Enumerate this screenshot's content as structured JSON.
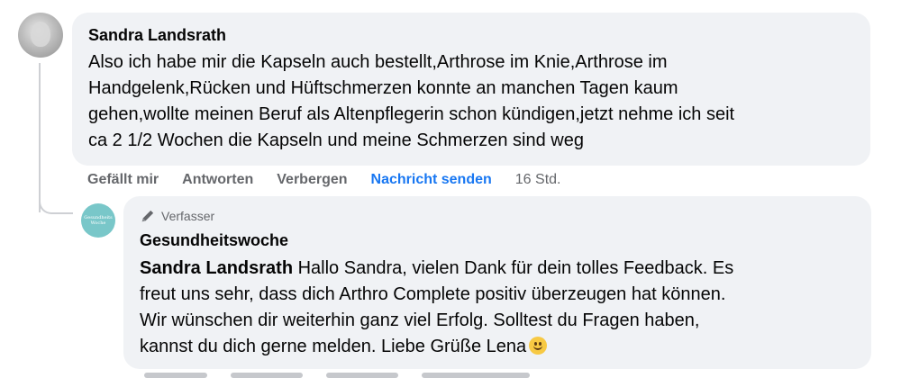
{
  "main_comment": {
    "author": "Sandra Landsrath",
    "lines": [
      "Also ich habe mir die Kapseln auch bestellt,Arthrose im Knie,Arthrose im",
      "Handgelenk,Rücken und Hüftschmerzen konnte an manchen Tagen kaum",
      "gehen,wollte meinen Beruf als Altenpflegerin schon kündigen,jetzt nehme ich seit",
      "ca 2 1/2 Wochen die Kapseln und meine Schmerzen sind weg"
    ]
  },
  "actions": {
    "like": "Gefällt mir",
    "reply": "Antworten",
    "hide": "Verbergen",
    "message": "Nachricht senden",
    "time": "16 Std."
  },
  "reply": {
    "badge": "Verfasser",
    "author": "Gesundheitswoche",
    "avatar_text": "Gesundheits Woche",
    "mention": "Sandra Landsrath",
    "lines": [
      " Hallo Sandra, vielen Dank für dein tolles Feedback. Es",
      "freut uns sehr, dass dich Arthro Complete positiv überzeugen hat können.",
      "Wir wünschen dir weiterhin ganz viel Erfolg. Solltest du Fragen haben,",
      "kannst du dich gerne melden. Liebe Grüße Lena"
    ]
  },
  "colors": {
    "bubble": "#f0f2f5",
    "link_blue": "#1877f2",
    "secondary_text": "#65676b",
    "reply_avatar": "#79c7c9"
  }
}
